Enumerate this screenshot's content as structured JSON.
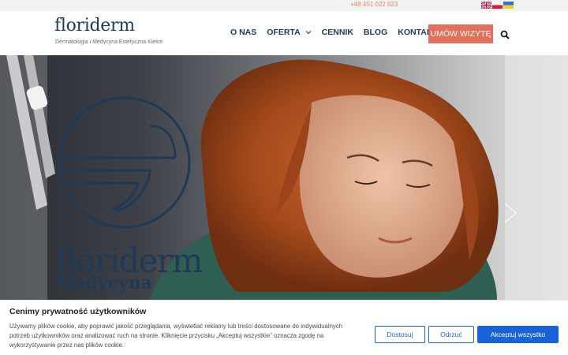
{
  "topbar": {
    "phone": "+48 451 022 823",
    "languages": [
      "English",
      "Polski",
      "Українська"
    ]
  },
  "header": {
    "logo": "floriderm",
    "tagline": "Dermatologia i Medycyna Estetyczna Kielce",
    "nav": [
      {
        "label": "O NAS"
      },
      {
        "label": "OFERTA",
        "has_dropdown": true
      },
      {
        "label": "CENNIK"
      },
      {
        "label": "BLOG"
      },
      {
        "label": "KONTAKT"
      }
    ],
    "cta_label": "UMÓW WIZYTĘ",
    "search_icon": "search-icon"
  },
  "hero": {
    "brand": "floriderm",
    "sub": "Medycyna",
    "accent": "#1f3a56"
  },
  "cookie": {
    "title": "Cenimy prywatność użytkowników",
    "text": "Używamy plików cookie, aby poprawić jakość przeglądania, wyświetlać reklamy lub treści dostosowane do indywidualnych potrzeb użytkowników oraz analizować ruch na stronie. Kliknięcie przycisku „Akceptuj wszystkie” oznacza zgodę na wykorzystywanie przez nas plików cookie.",
    "buttons": {
      "customize": "Dostosuj",
      "reject": "Odrzuć",
      "accept_all": "Akceptuj wszystko"
    },
    "accent": "#1863dc"
  }
}
